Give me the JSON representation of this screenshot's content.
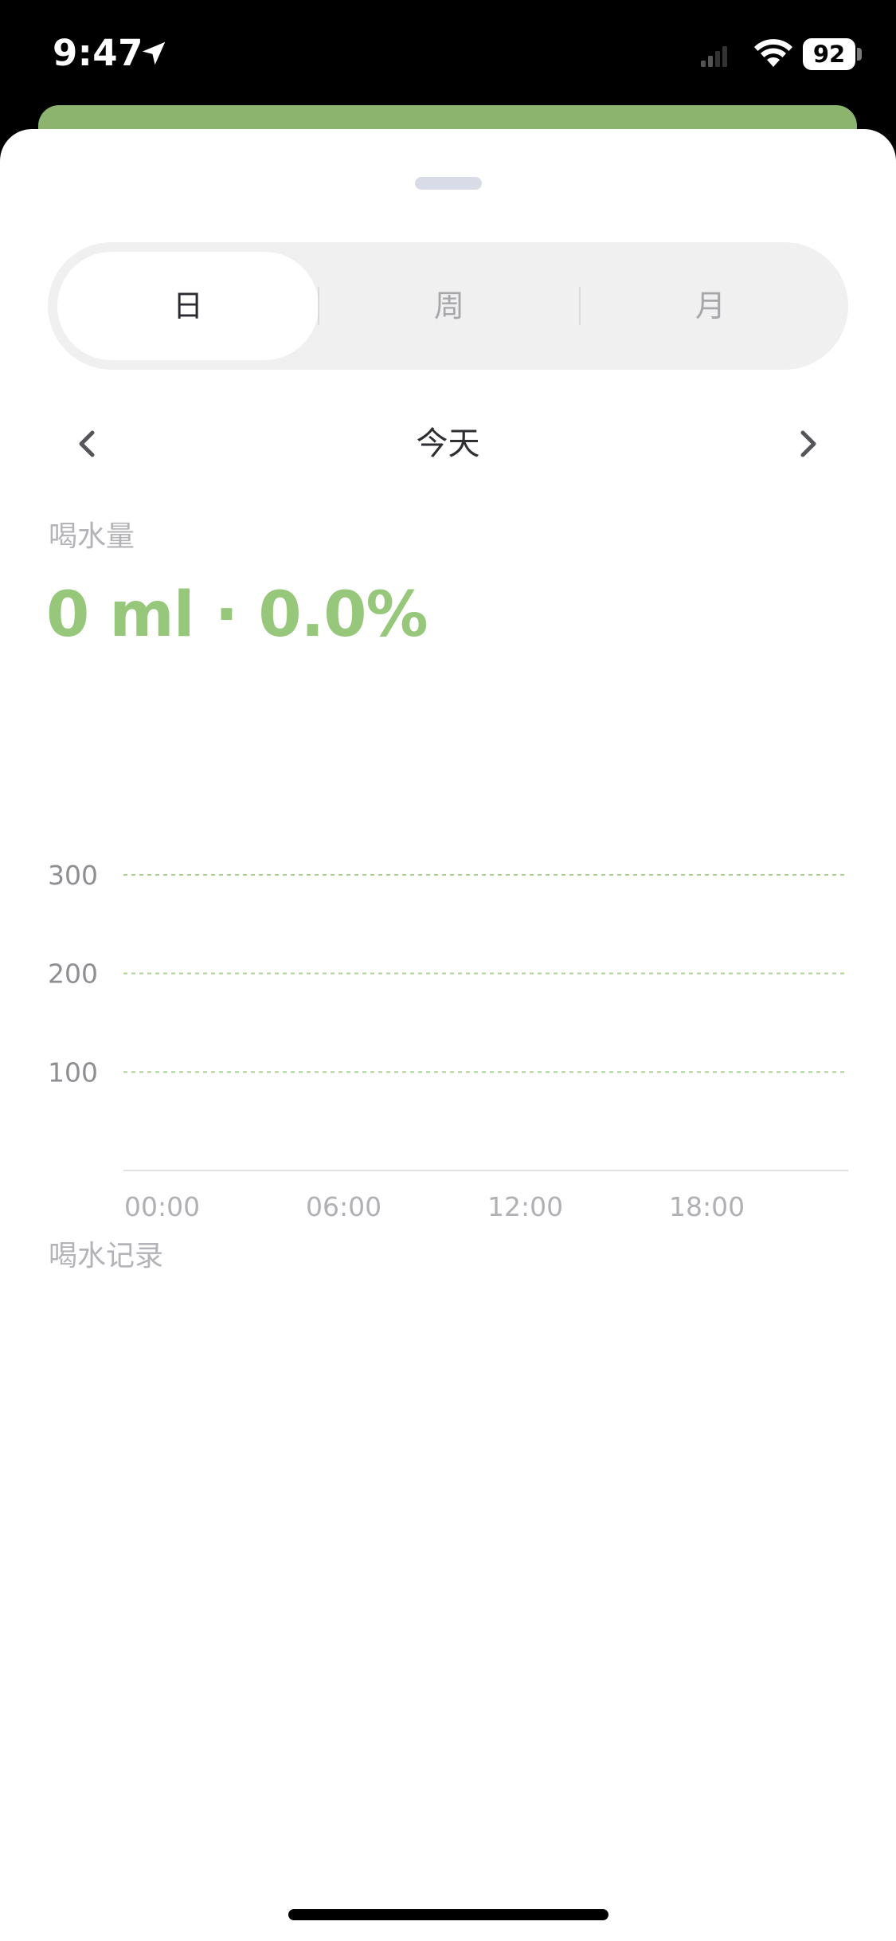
{
  "status_bar": {
    "time": "9:47",
    "battery": "92",
    "icons": [
      "location-arrow-icon",
      "cellular-signal-icon",
      "wifi-icon",
      "battery-icon"
    ]
  },
  "colors": {
    "accent_green": "#96c77a",
    "header_green": "#8db46e",
    "gridline": "#a6d48c"
  },
  "tabs": [
    {
      "label": "日",
      "active": true
    },
    {
      "label": "周",
      "active": false
    },
    {
      "label": "月",
      "active": false
    }
  ],
  "date_nav": {
    "title": "今天",
    "prev_icon": "chevron-left-icon",
    "next_icon": "chevron-right-icon"
  },
  "intake": {
    "label": "喝水量",
    "summary": "0 ml · 0.0%"
  },
  "chart_data": {
    "type": "bar",
    "categories": [
      "00:00",
      "06:00",
      "12:00",
      "18:00"
    ],
    "values": [
      0,
      0,
      0,
      0
    ],
    "y_ticks": [
      "300",
      "200",
      "100"
    ],
    "ylim": [
      0,
      300
    ],
    "grid": true,
    "title": "",
    "xlabel": "",
    "ylabel": ""
  },
  "records": {
    "label": "喝水记录"
  }
}
